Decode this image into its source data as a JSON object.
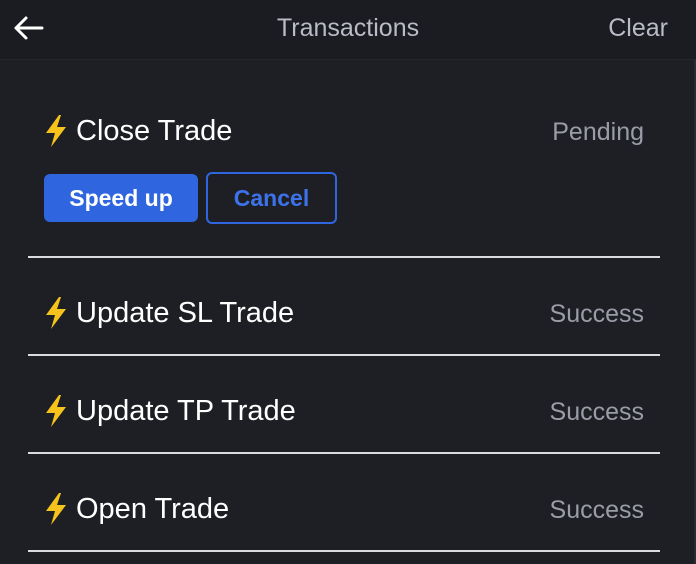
{
  "header": {
    "title": "Transactions",
    "clear_label": "Clear",
    "back_icon": "arrow-left-icon"
  },
  "colors": {
    "background": "#1e1f24",
    "accent": "#2f66e0",
    "bolt": "#f6c31c",
    "muted_text": "#9a9da7",
    "divider": "#d9dbe1"
  },
  "transactions": [
    {
      "icon": "lightning-bolt-icon",
      "name": "Close Trade",
      "status": "Pending",
      "actions": {
        "speed_up": "Speed up",
        "cancel": "Cancel"
      }
    },
    {
      "icon": "lightning-bolt-icon",
      "name": "Update SL Trade",
      "status": "Success"
    },
    {
      "icon": "lightning-bolt-icon",
      "name": "Update TP Trade",
      "status": "Success"
    },
    {
      "icon": "lightning-bolt-icon",
      "name": "Open Trade",
      "status": "Success"
    }
  ]
}
